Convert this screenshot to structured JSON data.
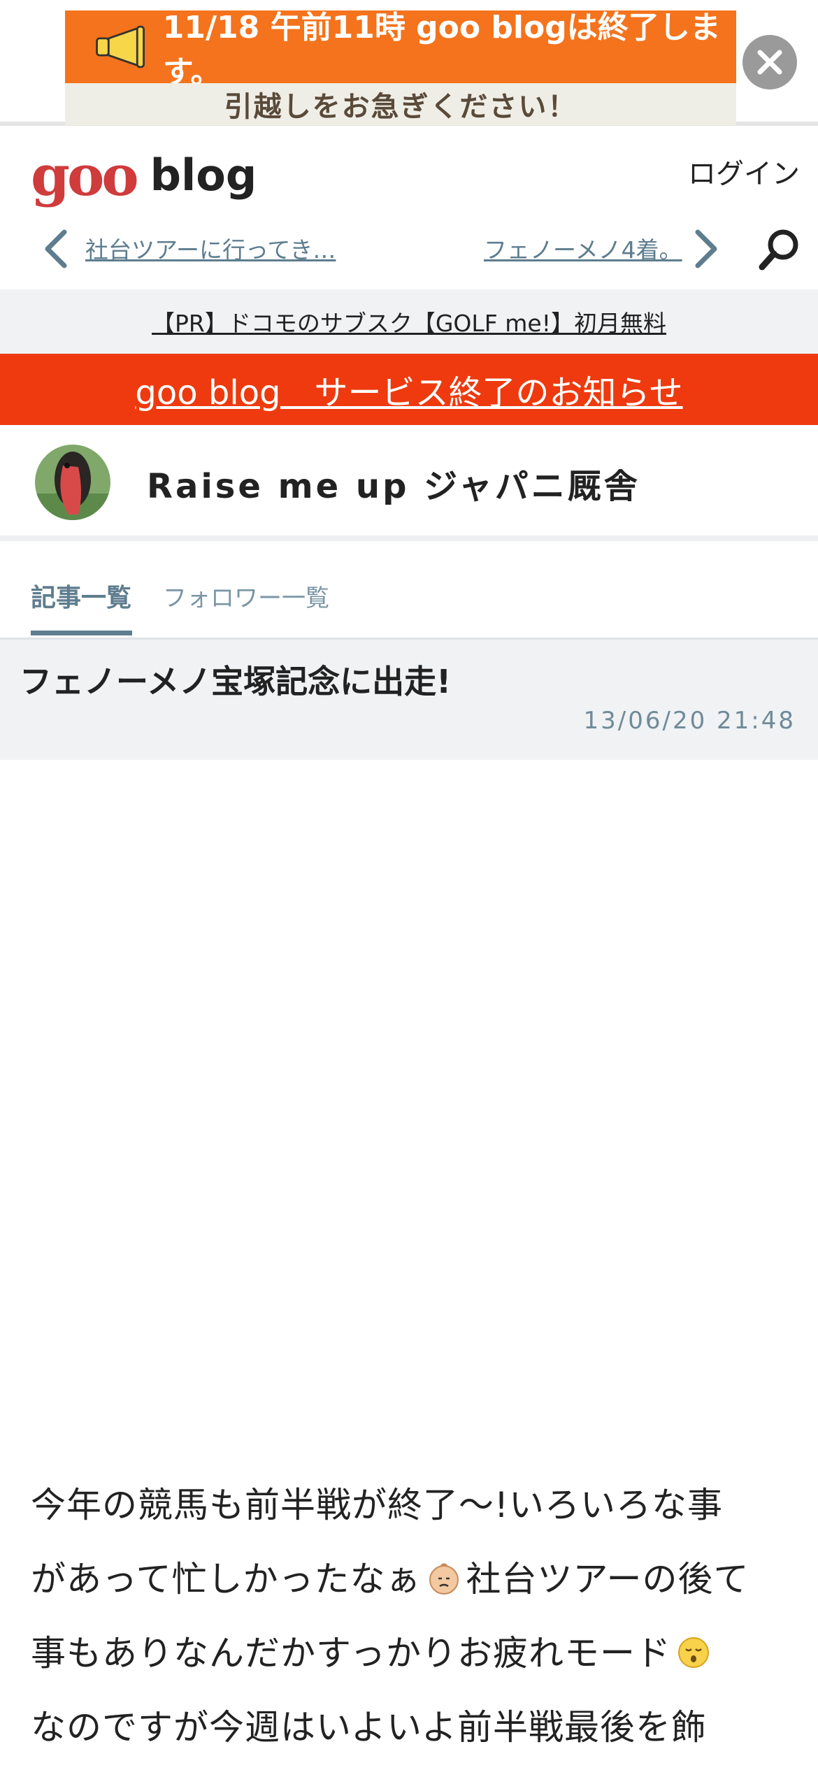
{
  "banner": {
    "line1": "11/18 午前11時 goo blogは終了します。",
    "line2": "引越しをお急ぎください！"
  },
  "header": {
    "logo_goo": "goo",
    "logo_blog": "blog",
    "login": "ログイン"
  },
  "nav": {
    "prev": "社台ツアーに行ってき…",
    "next": "フェノーメノ4着。"
  },
  "pr": {
    "text": "【PR】ドコモのサブスク【GOLF me!】初月無料"
  },
  "notice": {
    "text": "goo blog　サービス終了のお知らせ"
  },
  "blog": {
    "title": "Raise me up ジャパニ厩舎"
  },
  "tabs": [
    {
      "label": "記事一覧",
      "active": true
    },
    {
      "label": "フォロワー一覧",
      "active": false
    }
  ],
  "article": {
    "title": "フェノーメノ宝塚記念に出走!",
    "date": "13/06/20 21:48",
    "body": {
      "line1": "今年の競馬も前半戦が終了～!いろいろな事",
      "line2a": "があって忙しかったなぁ",
      "line2b": "社台ツアーの後て",
      "line3": "事もありなんだかすっかりお疲れモード",
      "line4": "なのですが今週はいよいよ前半戦最後を飾"
    }
  },
  "colors": {
    "banner_orange": "#f4731c",
    "notice_red": "#ee3a0e",
    "logo_red": "#d03b3b",
    "link_slate": "#5e7d8f"
  }
}
